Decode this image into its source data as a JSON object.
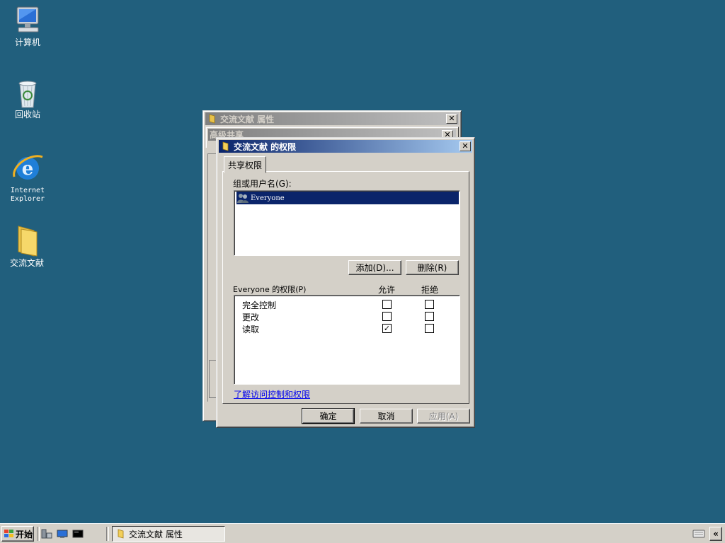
{
  "desktop": {
    "icons": [
      {
        "label": "计算机",
        "icon": "computer-icon"
      },
      {
        "label": "回收站",
        "icon": "recycle-bin-icon"
      },
      {
        "label_line1": "Internet",
        "label_line2": "Explorer",
        "icon": "internet-explorer-icon"
      },
      {
        "label": "交流文献",
        "icon": "folder-icon"
      }
    ]
  },
  "properties_window": {
    "title": "交流文献 属性"
  },
  "advanced_sharing_window": {
    "title": "高级共享"
  },
  "permissions_dialog": {
    "title": "交流文献 的权限",
    "tab": "共享权限",
    "group_label": "组或用户名(G):",
    "users": [
      {
        "name": "Everyone",
        "selected": true
      }
    ],
    "add_button": "添加(D)...",
    "remove_button": "删除(R)",
    "perm_label": "Everyone 的权限(P)",
    "allow_header": "允许",
    "deny_header": "拒绝",
    "permissions": [
      {
        "name": "完全控制",
        "allow": false,
        "deny": false
      },
      {
        "name": "更改",
        "allow": false,
        "deny": false
      },
      {
        "name": "读取",
        "allow": true,
        "deny": false
      }
    ],
    "help_link": "了解访问控制和权限",
    "ok_button": "确定",
    "cancel_button": "取消",
    "apply_button": "应用(A)"
  },
  "taskbar": {
    "start_label": "开始",
    "task_label": "交流文献 属性",
    "collapse_label": "«"
  },
  "colors": {
    "desktop": "#215f7d",
    "active_title_start": "#0a246a",
    "selection": "#0a246a",
    "link": "#0000ee"
  }
}
